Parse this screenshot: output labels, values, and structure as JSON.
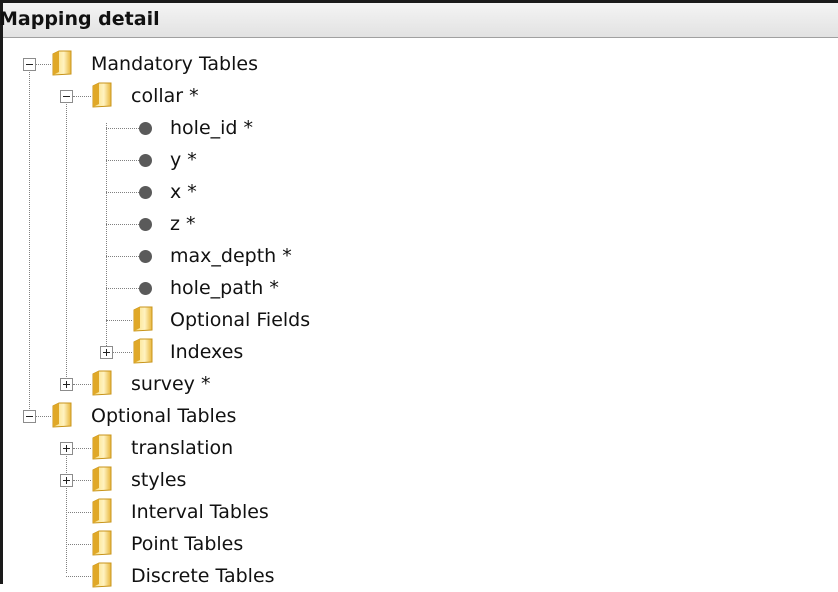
{
  "header": {
    "title": "Mapping detail"
  },
  "tree": {
    "mandatory": {
      "label": "Mandatory Tables"
    },
    "collar": {
      "label": "collar *"
    },
    "fields": [
      {
        "label": "hole_id *"
      },
      {
        "label": "y *"
      },
      {
        "label": "x *"
      },
      {
        "label": "z *"
      },
      {
        "label": "max_depth *"
      },
      {
        "label": "hole_path *"
      }
    ],
    "optional_fields": {
      "label": "Optional Fields"
    },
    "indexes": {
      "label": "Indexes"
    },
    "survey": {
      "label": "survey *"
    },
    "optional": {
      "label": "Optional Tables"
    },
    "translation": {
      "label": "translation"
    },
    "styles": {
      "label": "styles"
    },
    "interval_tables": {
      "label": "Interval Tables"
    },
    "point_tables": {
      "label": "Point Tables"
    },
    "discrete_tables": {
      "label": "Discrete Tables"
    }
  },
  "colors": {
    "folder_light": "#fde39a",
    "folder_dark": "#d9a520",
    "dot": "#5a5a5a",
    "tree_line": "#808080"
  }
}
